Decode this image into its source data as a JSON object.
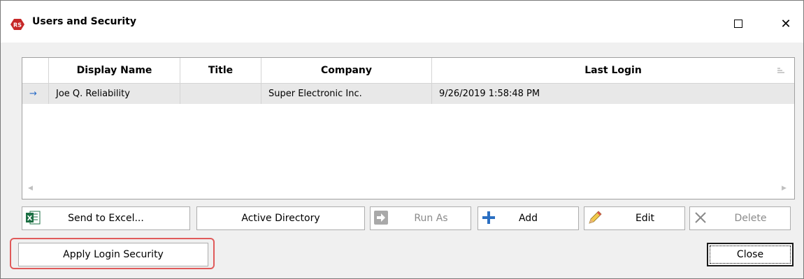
{
  "window": {
    "title": "Users and Security",
    "logo_text": "RS",
    "accent": "#c62828"
  },
  "grid": {
    "columns": [
      "Display Name",
      "Title",
      "Company",
      "Last Login"
    ],
    "rows": [
      {
        "display_name": "Joe Q. Reliability",
        "title": "",
        "company": "Super Electronic Inc.",
        "last_login": "9/26/2019 1:58:48 PM"
      }
    ],
    "current_row_indicator": "→"
  },
  "toolbar": {
    "send_to_excel": "Send to Excel...",
    "active_directory": "Active Directory",
    "run_as": "Run As",
    "add": "Add",
    "edit": "Edit",
    "delete": "Delete"
  },
  "footer": {
    "apply_login_security": "Apply Login Security",
    "close": "Close"
  },
  "icons": {
    "excel": "excel-icon",
    "run_as": "arrow-right-icon",
    "add": "plus-icon",
    "edit": "pencil-icon",
    "delete": "x-icon"
  }
}
